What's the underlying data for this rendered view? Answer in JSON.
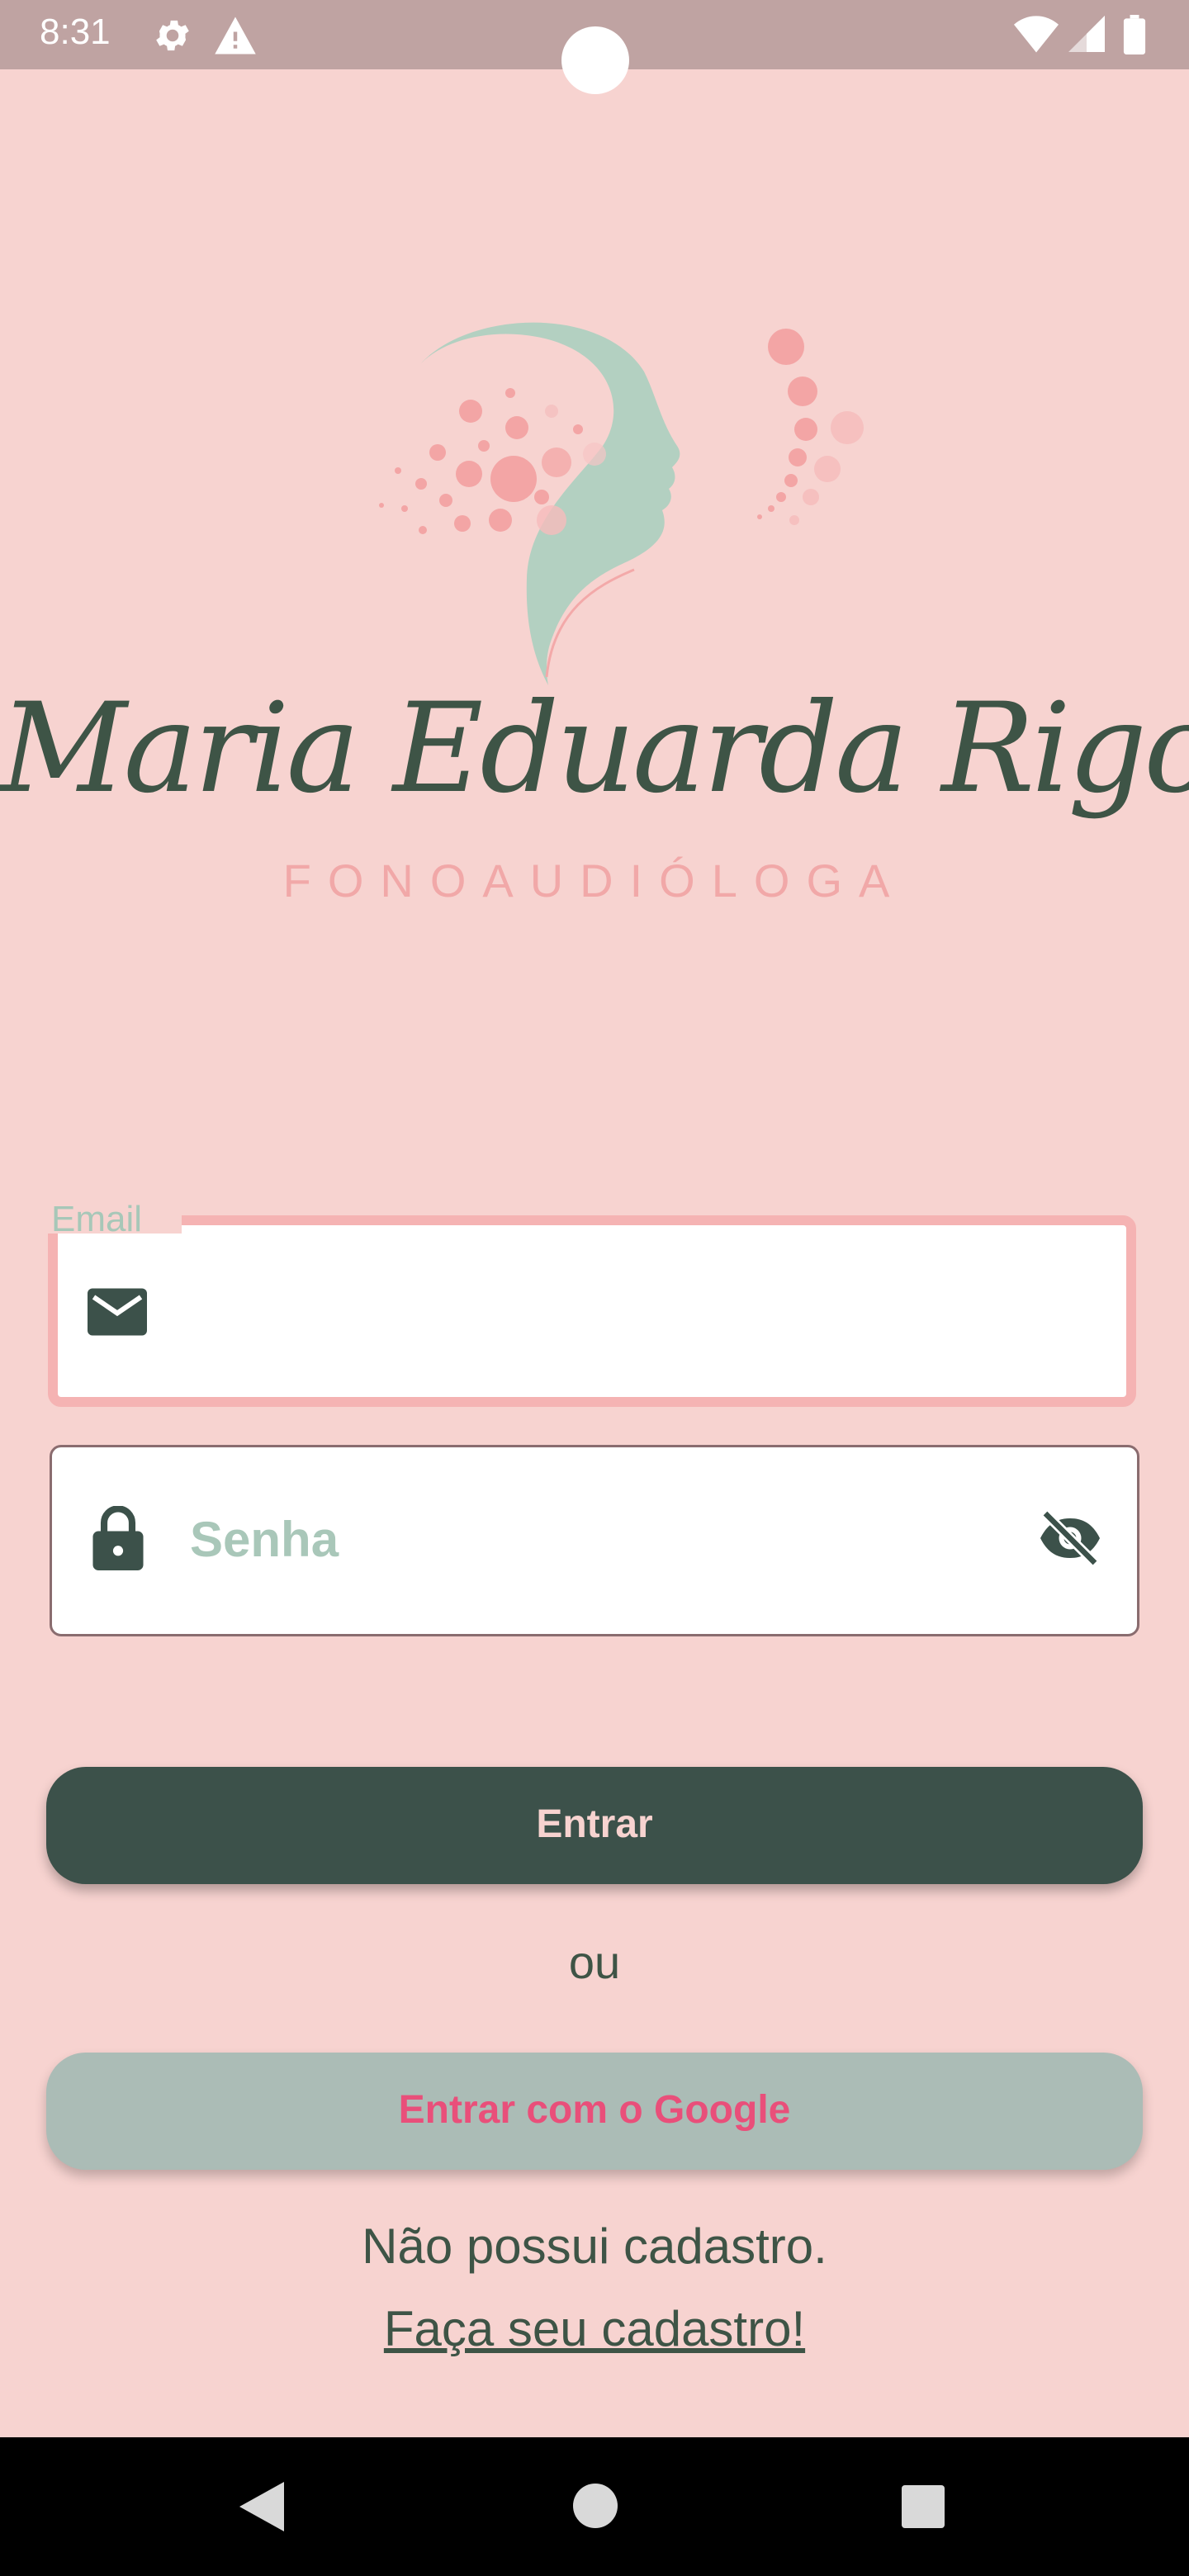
{
  "status_bar": {
    "time": "8:31",
    "icons": [
      "gear-icon",
      "warning-icon",
      "wifi-icon",
      "cell-signal-icon",
      "battery-icon"
    ]
  },
  "brand": {
    "name": "Maria Eduarda Rigotto",
    "subtitle": "FONOAUDIÓLOGA"
  },
  "form": {
    "email_label": "Email",
    "email_value": "",
    "password_placeholder": "Senha",
    "login_button": "Entrar",
    "or_text": "ou",
    "google_button": "Entrar com o Google",
    "no_account_text": "Não possui cadastro.",
    "signup_link": "Faça seu cadastro!"
  },
  "colors": {
    "background": "#f7d3d0",
    "primary_dark_green": "#3c514a",
    "accent_pink": "#e94f7a",
    "sage": "#abbcb6",
    "focus_border": "#f5b3b3"
  },
  "nav_bar": {
    "icons": [
      "back-icon",
      "home-icon",
      "recents-icon"
    ]
  }
}
